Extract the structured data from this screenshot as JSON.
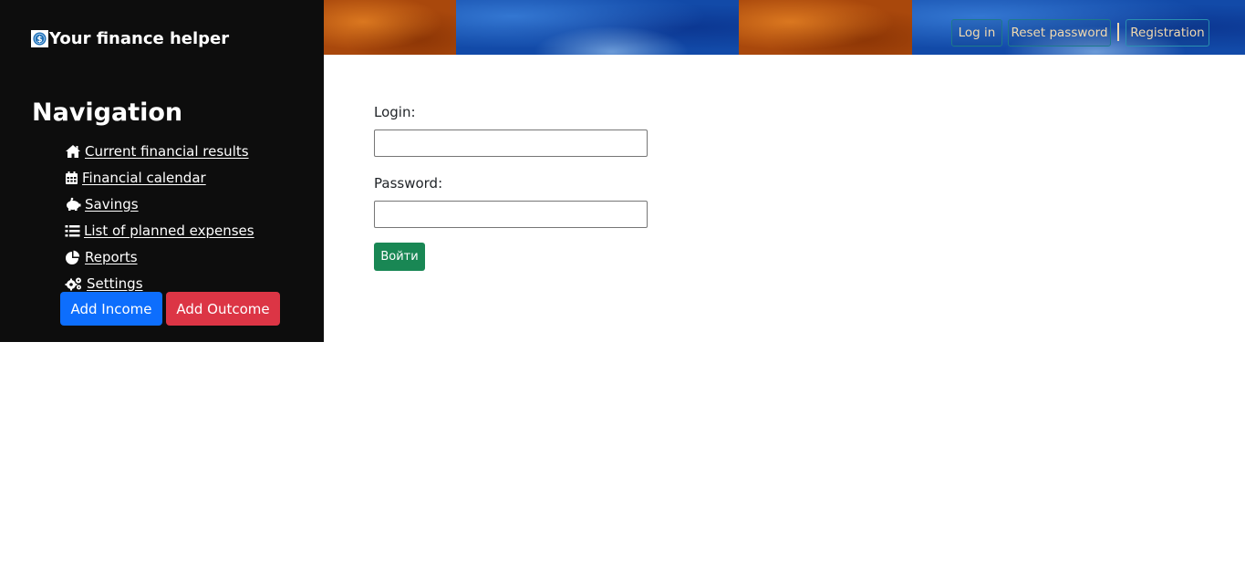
{
  "brand": {
    "title": "Your finance helper",
    "icon": "dollar-coin-icon"
  },
  "navigation": {
    "title": "Navigation",
    "items": [
      {
        "label": "Current financial results",
        "icon": "home-icon"
      },
      {
        "label": "Financial calendar",
        "icon": "calendar-icon"
      },
      {
        "label": "Savings",
        "icon": "piggy-bank-icon"
      },
      {
        "label": "List of planned expenses",
        "icon": "list-icon"
      },
      {
        "label": "Reports",
        "icon": "pie-chart-icon"
      },
      {
        "label": "Settings",
        "icon": "gears-icon"
      }
    ]
  },
  "actions": {
    "add_income": "Add Income",
    "add_outcome": "Add Outcome"
  },
  "header": {
    "login": "Log in",
    "reset_password": "Reset password",
    "registration": "Registration"
  },
  "form": {
    "login_label": "Login:",
    "login_value": "",
    "password_label": "Password:",
    "password_value": "",
    "submit": "Войти"
  },
  "colors": {
    "sidebar_bg": "#0d0d0d",
    "primary": "#0d6efd",
    "danger": "#dc3545",
    "success": "#198754",
    "header_button_text": "#f0d9b0",
    "header_button_border": "#1d7a8a"
  }
}
